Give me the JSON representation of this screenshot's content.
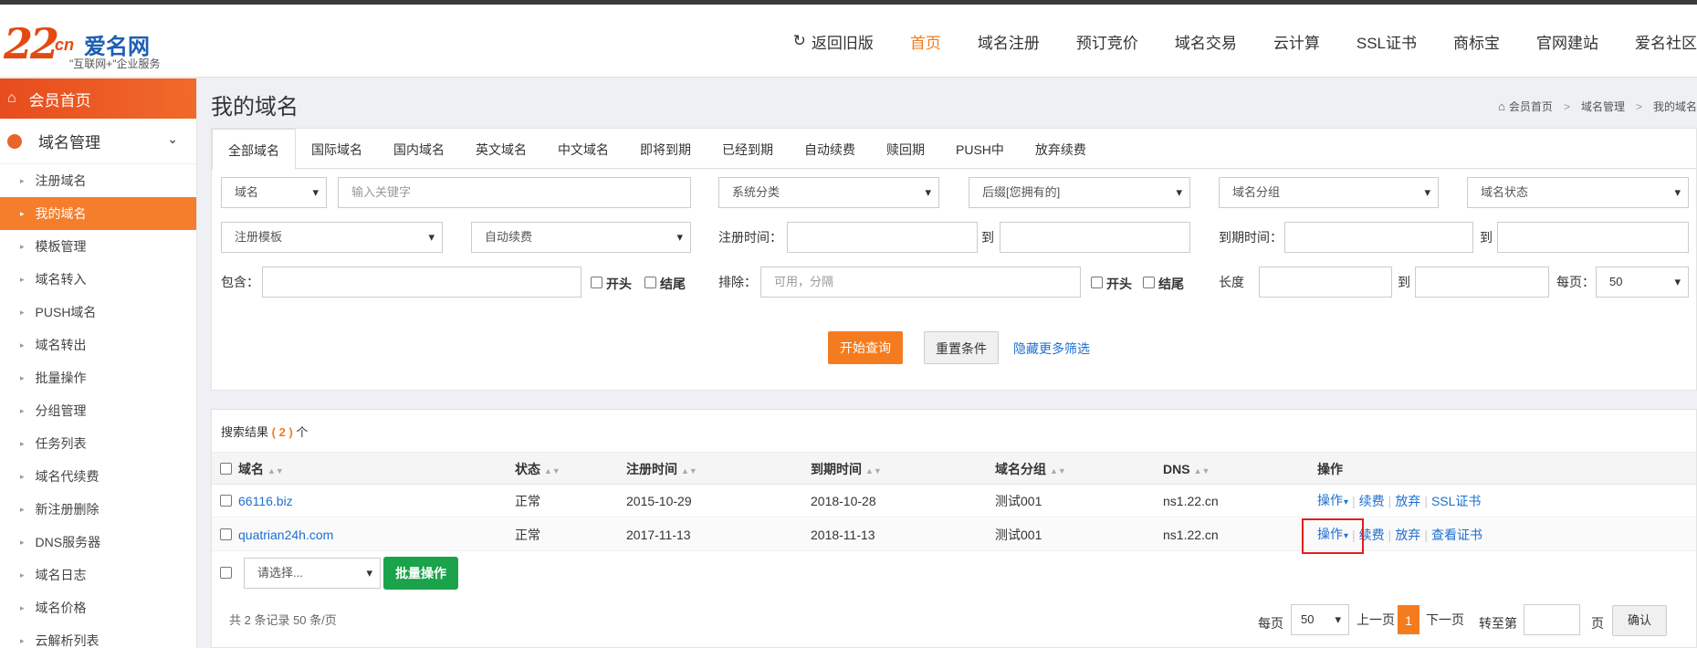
{
  "header": {
    "logo": {
      "number": "22",
      "cn": "cn",
      "name": "爱名网",
      "slogan": "\"互联网+\"企业服务"
    },
    "nav": [
      {
        "label": "返回旧版",
        "icon": "switch-icon"
      },
      {
        "label": "首页",
        "active": true
      },
      {
        "label": "域名注册"
      },
      {
        "label": "预订竞价"
      },
      {
        "label": "域名交易"
      },
      {
        "label": "云计算"
      },
      {
        "label": "SSL证书"
      },
      {
        "label": "商标宝"
      },
      {
        "label": "官网建站"
      },
      {
        "label": "爱名社区"
      }
    ]
  },
  "sidebar": {
    "home": "会员首页",
    "group": "域名管理",
    "items": [
      "注册域名",
      "我的域名",
      "模板管理",
      "域名转入",
      "PUSH域名",
      "域名转出",
      "批量操作",
      "分组管理",
      "任务列表",
      "域名代续费",
      "新注册删除",
      "DNS服务器",
      "域名日志",
      "域名价格",
      "云解析列表"
    ],
    "active_index": 1
  },
  "page": {
    "title": "我的域名",
    "breadcrumb": [
      "会员首页",
      "域名管理",
      "我的域名"
    ],
    "breadcrumb_sep": ">"
  },
  "tabs": [
    "全部域名",
    "国际域名",
    "国内域名",
    "英文域名",
    "中文域名",
    "即将到期",
    "已经到期",
    "自动续费",
    "赎回期",
    "PUSH中",
    "放弃续费"
  ],
  "filters": {
    "domain_type": "域名",
    "keyword_placeholder": "输入关键字",
    "system_category": "系统分类",
    "suffix": "后缀[您拥有的]",
    "group": "域名分组",
    "status": "域名状态",
    "template": "注册模板",
    "auto_renew": "自动续费",
    "reg_time_label": "注册时间：",
    "to": "到",
    "expire_time_label": "到期时间：",
    "include_label": "包含：",
    "exclude_label": "排除：",
    "exclude_placeholder": "可用，分隔",
    "starts_label": "开头",
    "ends_label": "结尾",
    "length_label": "长度",
    "per_page_label": "每页：",
    "per_page_value": "50"
  },
  "actions": {
    "search": "开始查询",
    "reset": "重置条件",
    "hide_more": "隐藏更多筛选"
  },
  "results": {
    "prefix": "搜索结果",
    "count": "2",
    "suffix": "个",
    "columns": [
      "域名",
      "状态",
      "注册时间",
      "到期时间",
      "域名分组",
      "DNS",
      "操作"
    ],
    "rows": [
      {
        "domain": "66116.biz",
        "status": "正常",
        "reg": "2015-10-29",
        "exp": "2018-10-28",
        "group": "测试001",
        "dns": "ns1.22.cn",
        "ops": [
          "操作",
          "续费",
          "放弃",
          "SSL证书"
        ]
      },
      {
        "domain": "quatrian24h.com",
        "status": "正常",
        "reg": "2017-11-13",
        "exp": "2018-11-13",
        "group": "测试001",
        "dns": "ns1.22.cn",
        "ops": [
          "操作",
          "续费",
          "放弃",
          "查看证书"
        ]
      }
    ]
  },
  "bulk": {
    "select_placeholder": "请选择...",
    "button": "批量操作"
  },
  "footer": {
    "summary": "共 2 条记录 50 条/页",
    "per_page_label": "每页",
    "per_page_value": "50",
    "prev": "上一页",
    "current": "1",
    "next": "下一页",
    "goto_label": "转至第",
    "page_unit": "页",
    "confirm": "确认"
  },
  "colors": {
    "accent": "#f57c1e",
    "link": "#1d6fce",
    "green": "#1aa34a",
    "highlight": "#e02020"
  }
}
